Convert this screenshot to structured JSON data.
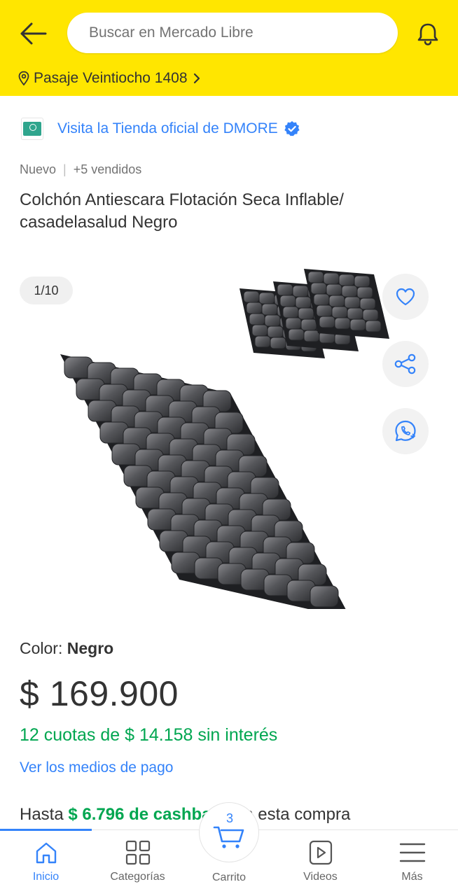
{
  "header": {
    "search_placeholder": "Buscar en Mercado Libre",
    "location": "Pasaje Veintiocho 1408",
    "background": "#ffe600"
  },
  "store": {
    "link_text": "Visita la Tienda oficial de DMORE",
    "accent": "#3483fa"
  },
  "product": {
    "condition": "Nuevo",
    "sold": "+5 vendidos",
    "title": "Colchón Antiescara Flotación Seca Inflable/ casadelasalud Negro",
    "image_counter": "1/10",
    "color_label": "Color: ",
    "color_value": "Negro",
    "price": "$ 169.900",
    "installments": "12 cuotas de $ 14.158 sin interés",
    "payment_link": "Ver los medios de pago",
    "cashback_prefix": "Hasta ",
    "cashback_amount": "$ 6.796 de cashback",
    "cashback_suffix": " en esta compra",
    "green": "#00a650"
  },
  "gallery_actions": [
    "heart-icon",
    "share-icon",
    "whatsapp-icon"
  ],
  "bottom_nav": {
    "items": [
      {
        "label": "Inicio",
        "icon": "home-icon",
        "active": true
      },
      {
        "label": "Categorías",
        "icon": "grid-icon",
        "active": false
      },
      {
        "label": "Carrito",
        "icon": "cart-icon",
        "active": false
      },
      {
        "label": "Videos",
        "icon": "play-icon",
        "active": false
      },
      {
        "label": "Más",
        "icon": "menu-icon",
        "active": false
      }
    ],
    "cart_count": "3"
  }
}
